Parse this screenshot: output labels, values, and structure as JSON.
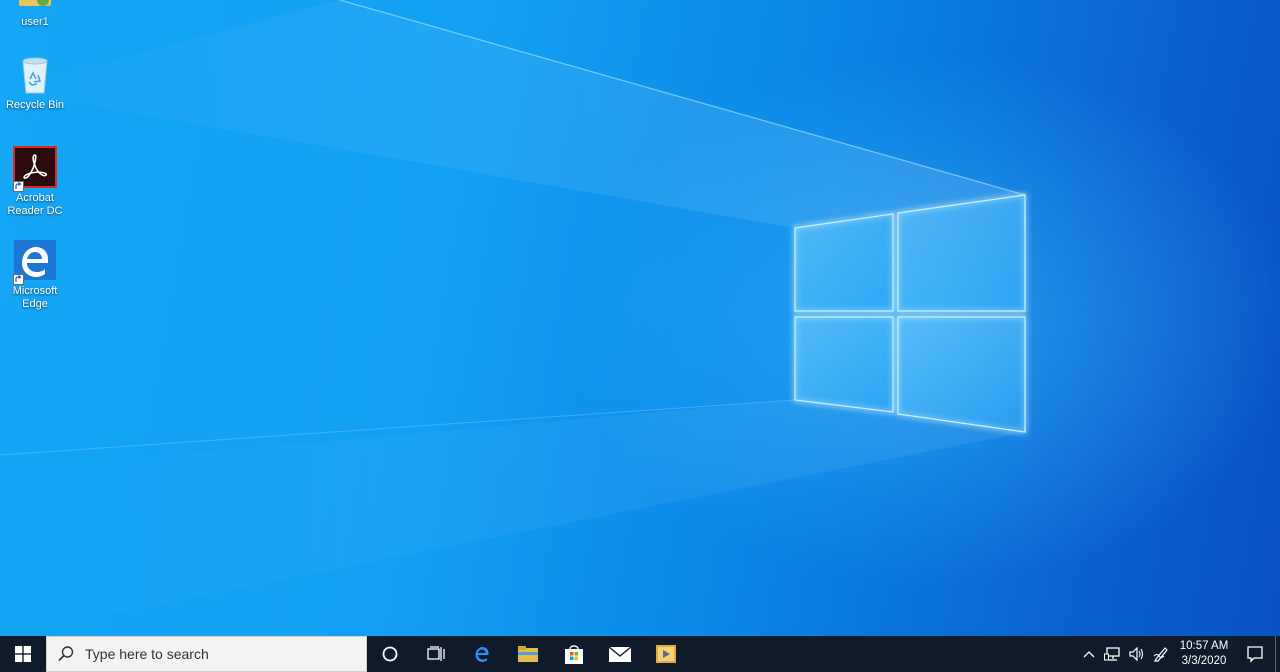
{
  "desktop": {
    "icons": [
      {
        "label": "user1",
        "icon": "user-folder-icon"
      },
      {
        "label": "Recycle Bin",
        "icon": "recycle-bin-icon"
      },
      {
        "label": "Acrobat Reader DC",
        "icon": "acrobat-reader-icon"
      },
      {
        "label": "Microsoft Edge",
        "icon": "edge-icon"
      }
    ]
  },
  "taskbar": {
    "start_icon": "windows-logo-icon",
    "search_placeholder": "Type here to search",
    "pinned": [
      {
        "name": "cortana",
        "icon": "circle-icon"
      },
      {
        "name": "task-view",
        "icon": "task-view-icon"
      },
      {
        "name": "edge",
        "icon": "edge-icon"
      },
      {
        "name": "file-explorer",
        "icon": "folder-icon"
      },
      {
        "name": "store",
        "icon": "store-bag-icon"
      },
      {
        "name": "mail",
        "icon": "mail-icon"
      },
      {
        "name": "media",
        "icon": "media-player-icon"
      }
    ],
    "tray": {
      "time": "10:57 AM",
      "date": "3/3/2020",
      "icons": [
        "chevron-up-icon",
        "network-icon",
        "volume-icon",
        "pen-icon",
        "notification-icon"
      ]
    }
  },
  "colors": {
    "taskbar": "#0f1a2b",
    "wallpaper_light": "#15a6f5",
    "wallpaper_dark": "#0a52c4"
  }
}
